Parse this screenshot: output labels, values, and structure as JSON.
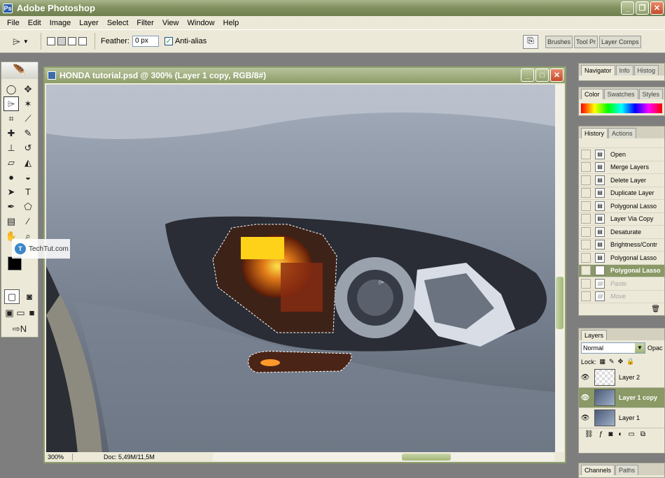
{
  "app": {
    "title": "Adobe Photoshop"
  },
  "menu": [
    "File",
    "Edit",
    "Image",
    "Layer",
    "Select",
    "Filter",
    "View",
    "Window",
    "Help"
  ],
  "options": {
    "feather_label": "Feather:",
    "feather_value": "0 px",
    "antialias_label": "Anti-alias",
    "antialias_checked": true,
    "well_tabs": [
      "Brushes",
      "Tool Pr",
      "Layer Comps"
    ]
  },
  "document": {
    "title": "HONDA tutorial.psd @ 300% (Layer 1 copy, RGB/8#)",
    "zoom": "300%",
    "doc_info": "Doc: 5,49M/11,5M"
  },
  "watermark": {
    "text": "TechTut.com"
  },
  "navigator": {
    "tabs": [
      "Navigator",
      "Info",
      "Histog"
    ]
  },
  "color": {
    "tabs": [
      "Color",
      "Swatches",
      "Styles"
    ]
  },
  "history": {
    "tabs": [
      "History",
      "Actions"
    ],
    "items": [
      {
        "label": "Open",
        "state": "normal"
      },
      {
        "label": "Merge Layers",
        "state": "normal"
      },
      {
        "label": "Delete Layer",
        "state": "normal"
      },
      {
        "label": "Duplicate Layer",
        "state": "normal"
      },
      {
        "label": "Polygonal Lasso",
        "state": "normal"
      },
      {
        "label": "Layer Via Copy",
        "state": "normal"
      },
      {
        "label": "Desaturate",
        "state": "normal"
      },
      {
        "label": "Brightness/Contr",
        "state": "normal"
      },
      {
        "label": "Polygonal Lasso",
        "state": "normal"
      },
      {
        "label": "Polygonal Lasso",
        "state": "current"
      },
      {
        "label": "Paste",
        "state": "undone"
      },
      {
        "label": "Move",
        "state": "undone"
      }
    ]
  },
  "layers": {
    "tab": "Layers",
    "blend_mode": "Normal",
    "opacity_label": "Opac",
    "lock_label": "Lock:",
    "items": [
      {
        "name": "Layer 2",
        "selected": false
      },
      {
        "name": "Layer 1 copy",
        "selected": true
      },
      {
        "name": "Layer 1",
        "selected": false
      }
    ]
  },
  "channels": {
    "tabs": [
      "Channels",
      "Paths"
    ]
  }
}
